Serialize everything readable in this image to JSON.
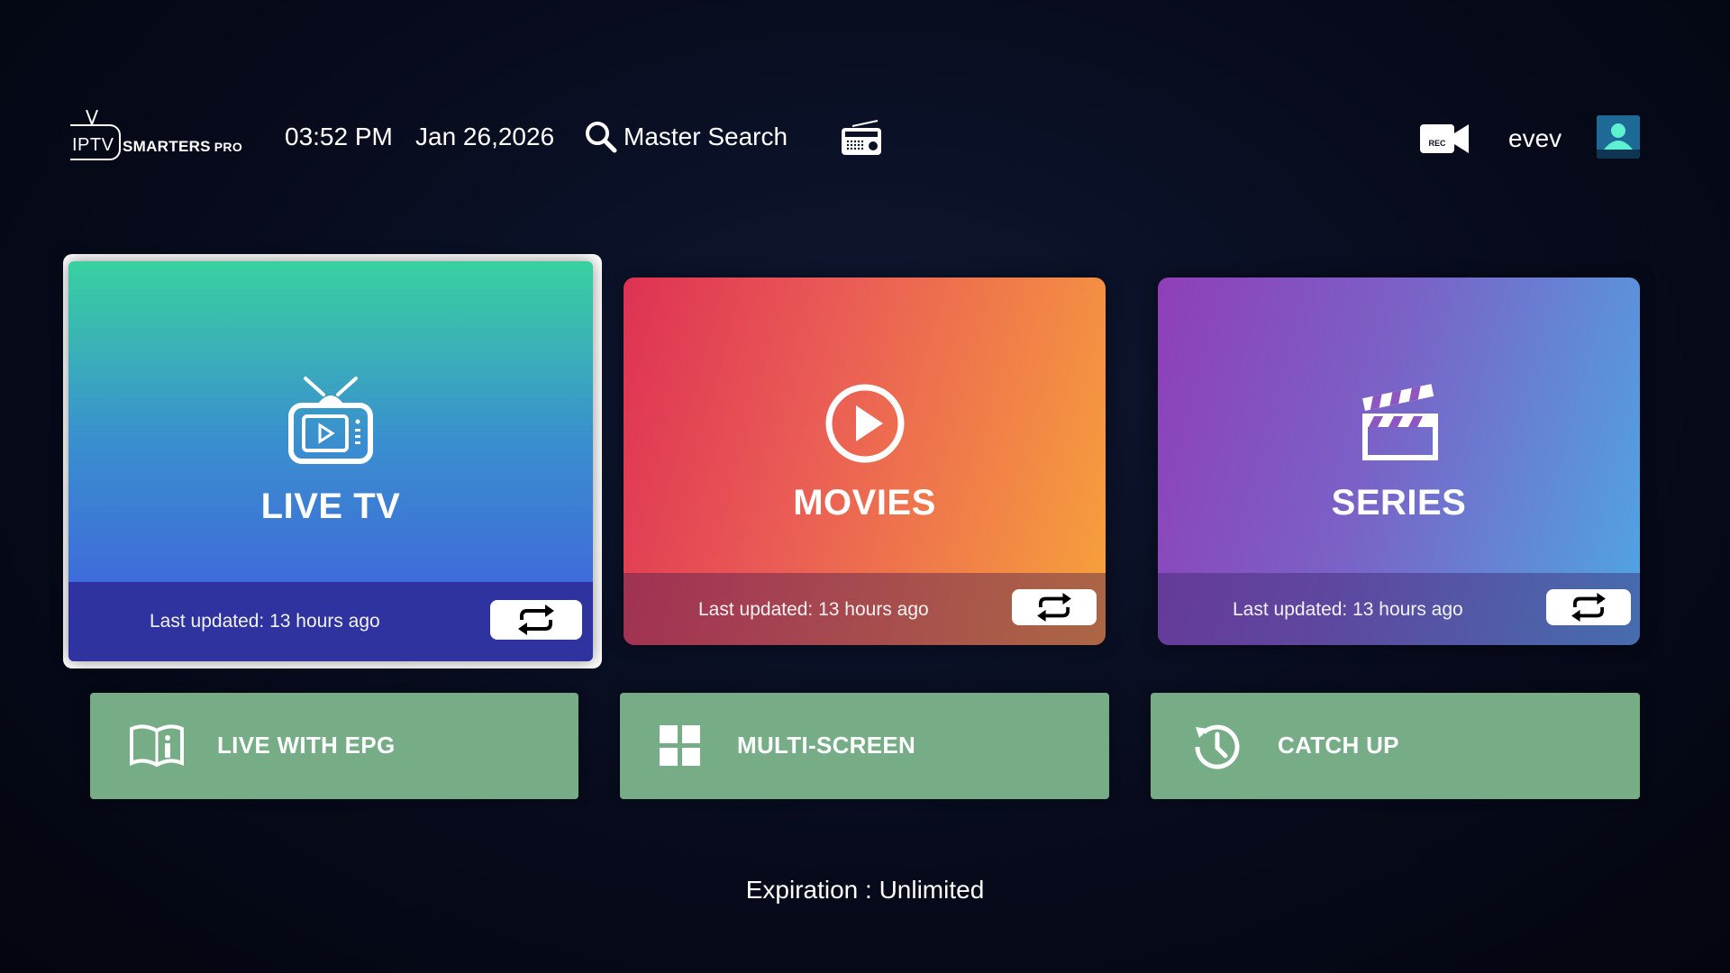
{
  "header": {
    "logo_iptv": "IPTV",
    "logo_brand": "SMARTERS",
    "logo_pro": "PRO",
    "time": "03:52 PM",
    "date": "Jan 26,2026",
    "search_label": "Master Search",
    "radio_icon": "radio-icon",
    "rec_icon": "rec-camera-icon",
    "rec_label": "REC",
    "username": "evev",
    "avatar_icon": "user-avatar-icon"
  },
  "tiles": {
    "live_tv": {
      "title": "LIVE TV",
      "icon": "tv-icon",
      "last_updated": "Last updated: 13 hours ago",
      "focused": true
    },
    "movies": {
      "title": "MOVIES",
      "icon": "play-circle-icon",
      "last_updated": "Last updated: 13 hours ago"
    },
    "series": {
      "title": "SERIES",
      "icon": "clapperboard-icon",
      "last_updated": "Last updated: 13 hours ago"
    }
  },
  "buttons": {
    "live_epg": {
      "label": "LIVE WITH EPG",
      "icon": "book-info-icon"
    },
    "multi_screen": {
      "label": "MULTI-SCREEN",
      "icon": "grid-icon"
    },
    "catch_up": {
      "label": "CATCH UP",
      "icon": "history-icon"
    }
  },
  "footer": {
    "expiration": "Expiration : Unlimited"
  },
  "colors": {
    "background": "#070b1c",
    "small_button": "#76ad87",
    "focus_ring": "#ffffff"
  }
}
